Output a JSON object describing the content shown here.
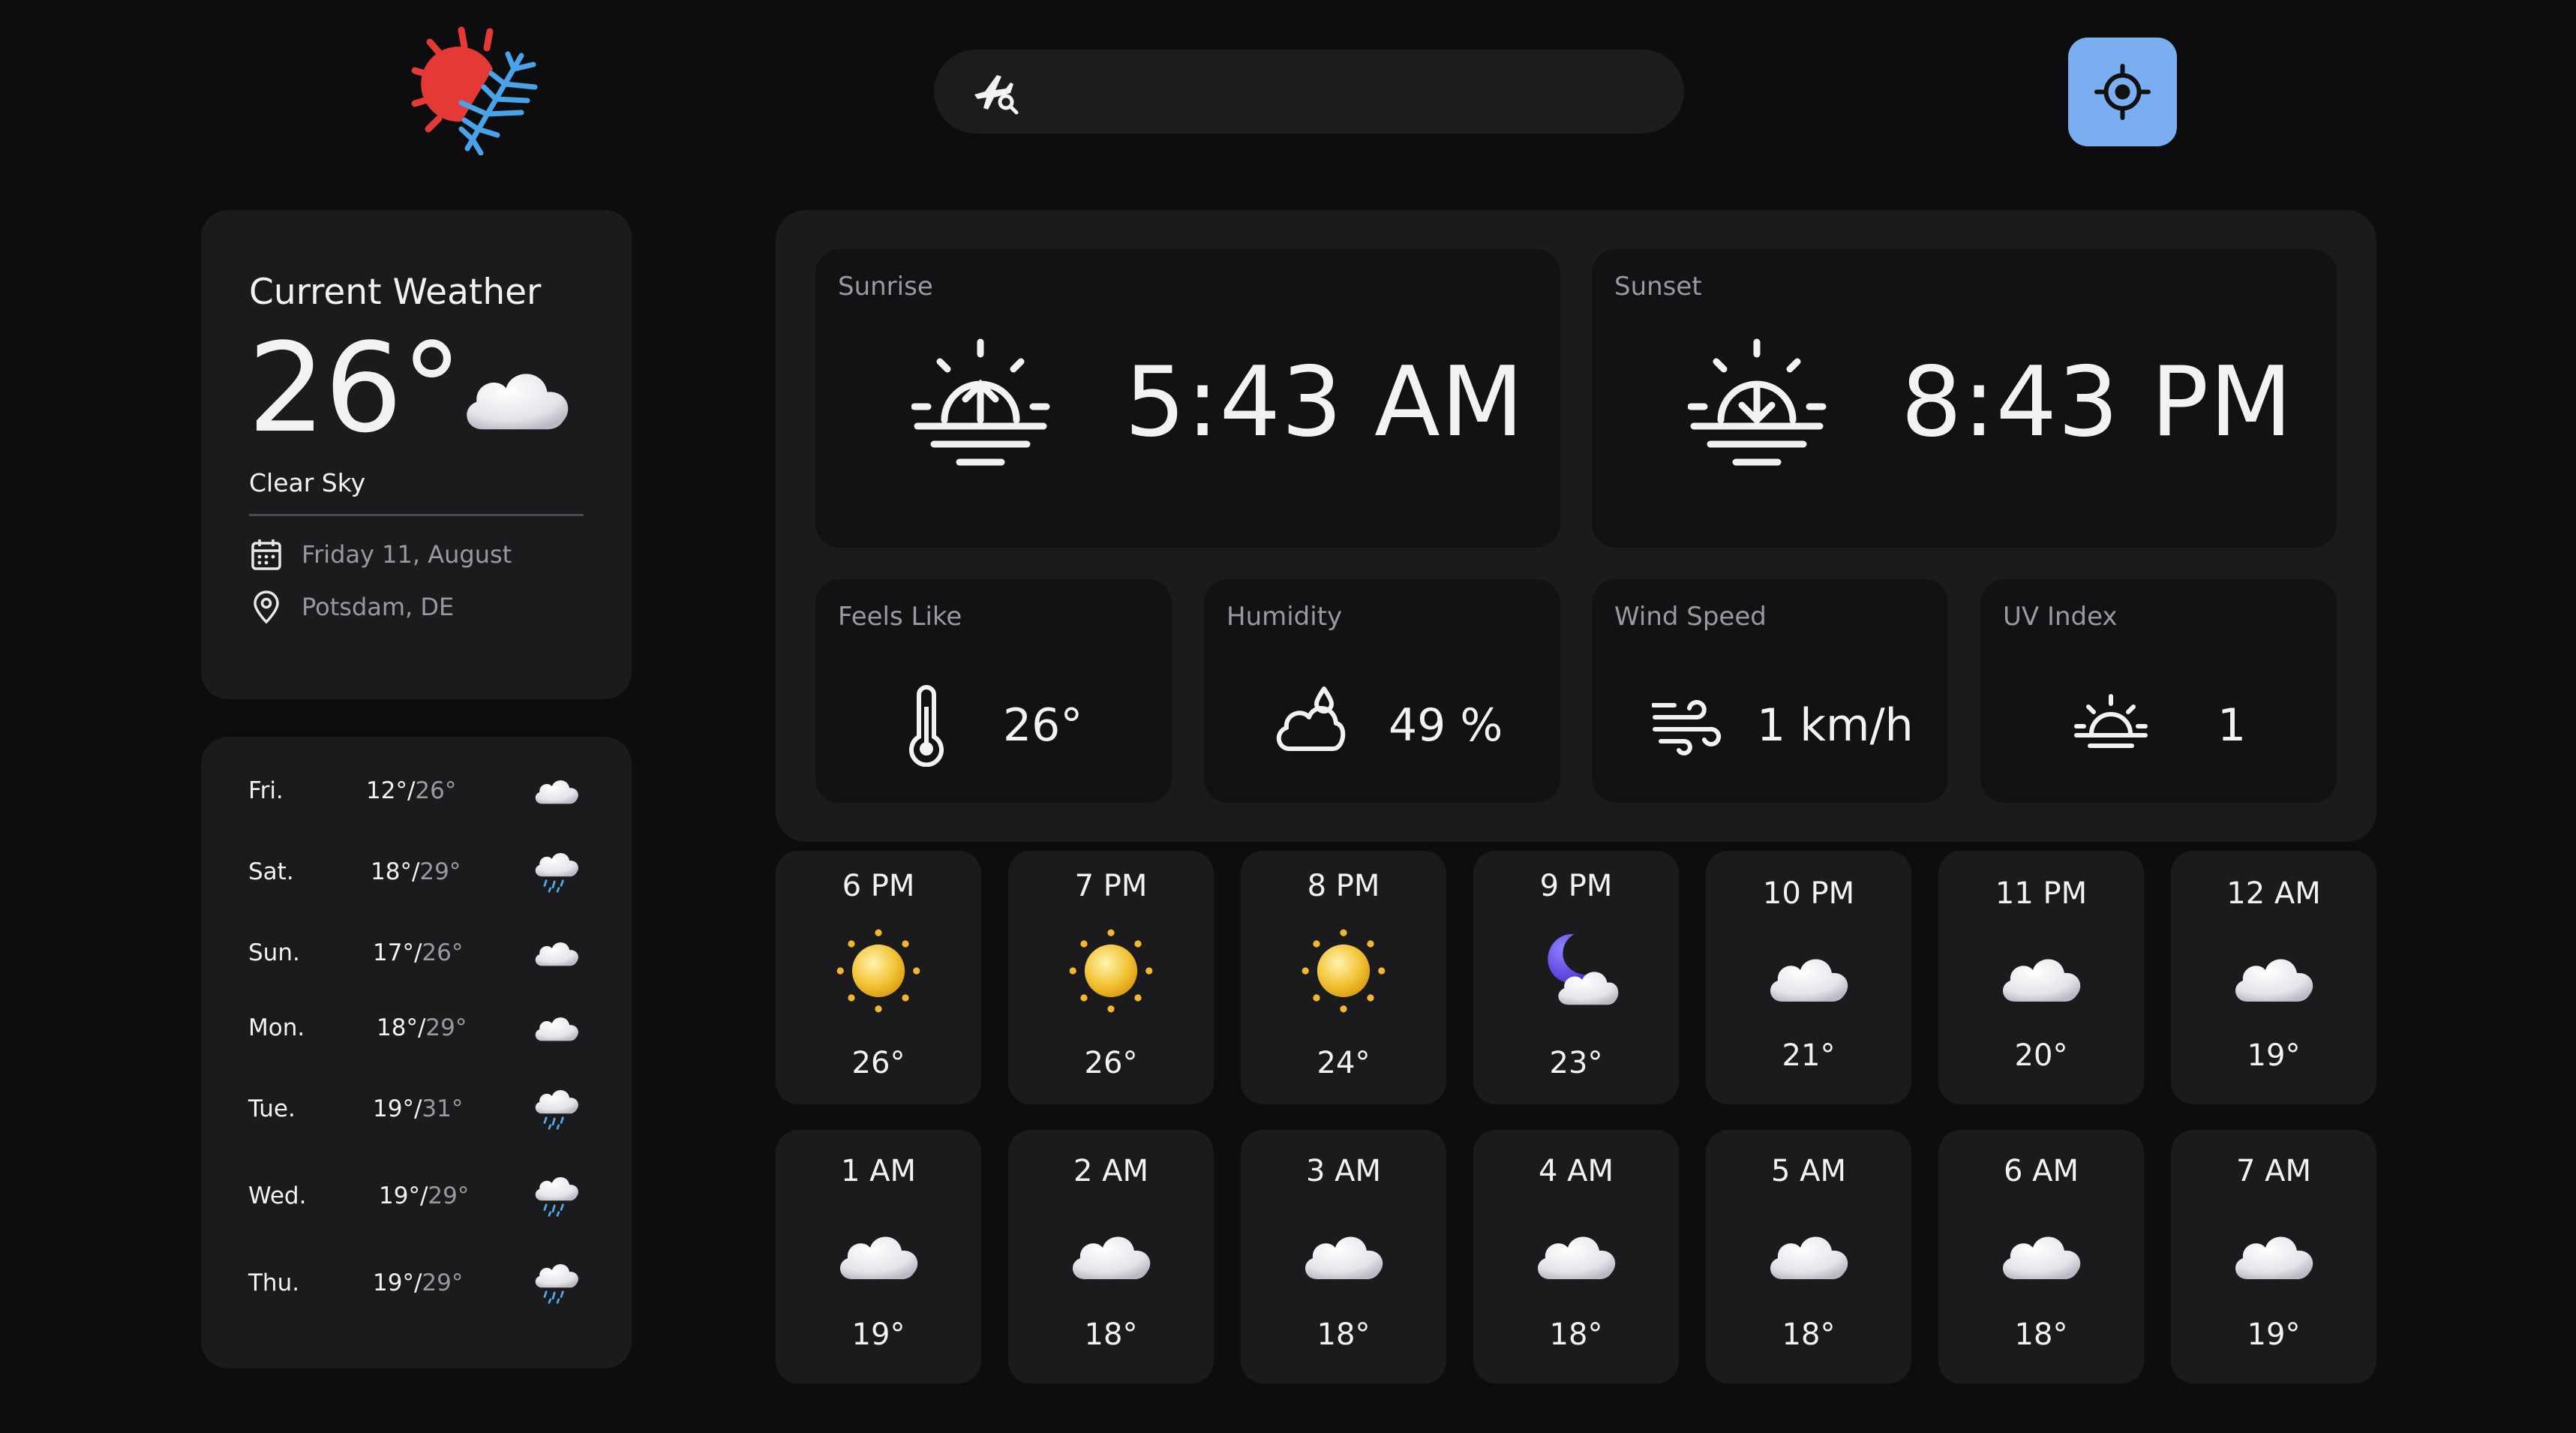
{
  "header": {
    "search_placeholder": "",
    "logo_icon": "sun-snowflake-logo",
    "search_icon": "plane-search-icon",
    "locate_icon": "crosshair-icon"
  },
  "current": {
    "title": "Current Weather",
    "temp": "26°",
    "description": "Clear Sky",
    "date": "Friday 11, August",
    "location": "Potsdam, DE",
    "icon": "cloud-icon"
  },
  "week": [
    {
      "day": "Fri.",
      "min": "12°",
      "max": "26°",
      "icon": "cloud"
    },
    {
      "day": "Sat.",
      "min": "18°",
      "max": "29°",
      "icon": "rain-cloud"
    },
    {
      "day": "Sun.",
      "min": "17°",
      "max": "26°",
      "icon": "cloud"
    },
    {
      "day": "Mon.",
      "min": "18°",
      "max": "29°",
      "icon": "cloud"
    },
    {
      "day": "Tue.",
      "min": "19°",
      "max": "31°",
      "icon": "rain-cloud"
    },
    {
      "day": "Wed.",
      "min": "19°",
      "max": "29°",
      "icon": "rain-cloud"
    },
    {
      "day": "Thu.",
      "min": "19°",
      "max": "29°",
      "icon": "rain-cloud"
    }
  ],
  "highlights": {
    "sunrise": {
      "label": "Sunrise",
      "time": "5:43 AM"
    },
    "sunset": {
      "label": "Sunset",
      "time": "8:43 PM"
    },
    "feels_like": {
      "label": "Feels Like",
      "value": "26°"
    },
    "humidity": {
      "label": "Humidity",
      "value": "49 %"
    },
    "wind": {
      "label": "Wind Speed",
      "value": "1 km/h"
    },
    "uv": {
      "label": "UV Index",
      "value": "1"
    }
  },
  "hourly": [
    {
      "time": "6 PM",
      "temp": "26°",
      "icon": "sun"
    },
    {
      "time": "7 PM",
      "temp": "26°",
      "icon": "sun"
    },
    {
      "time": "8 PM",
      "temp": "24°",
      "icon": "sun"
    },
    {
      "time": "9 PM",
      "temp": "23°",
      "icon": "moon-cloud"
    },
    {
      "time": "10 PM",
      "temp": "21°",
      "icon": "cloud"
    },
    {
      "time": "11 PM",
      "temp": "20°",
      "icon": "cloud"
    },
    {
      "time": "12 AM",
      "temp": "19°",
      "icon": "cloud"
    },
    {
      "time": "1 AM",
      "temp": "19°",
      "icon": "cloud"
    },
    {
      "time": "2 AM",
      "temp": "18°",
      "icon": "cloud"
    },
    {
      "time": "3 AM",
      "temp": "18°",
      "icon": "cloud"
    },
    {
      "time": "4 AM",
      "temp": "18°",
      "icon": "cloud"
    },
    {
      "time": "5 AM",
      "temp": "18°",
      "icon": "cloud"
    },
    {
      "time": "6 AM",
      "temp": "18°",
      "icon": "cloud"
    },
    {
      "time": "7 AM",
      "temp": "19°",
      "icon": "cloud"
    }
  ],
  "colors": {
    "background": "#0d0d0f",
    "card": "#1b1b1d",
    "tile": "#121214",
    "accent": "#7aaef0",
    "muted": "#9a9a9e",
    "logo_sun": "#e53935",
    "logo_snow": "#4aa3e8"
  }
}
